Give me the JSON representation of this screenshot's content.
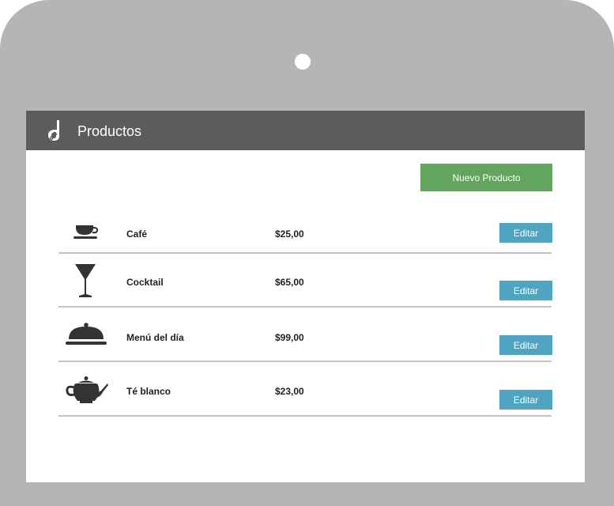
{
  "header": {
    "title": "Productos",
    "logo_icon": "whisk-logo-icon"
  },
  "actions": {
    "new_product_label": "Nuevo Producto"
  },
  "products": [
    {
      "icon": "coffee-cup-icon",
      "name": "Café",
      "price": "$25,00",
      "edit_label": "Editar"
    },
    {
      "icon": "cocktail-glass-icon",
      "name": "Cocktail",
      "price": "$65,00",
      "edit_label": "Editar"
    },
    {
      "icon": "cloche-icon",
      "name": "Menú del día",
      "price": "$99,00",
      "edit_label": "Editar"
    },
    {
      "icon": "teapot-icon",
      "name": "Té blanco",
      "price": "$23,00",
      "edit_label": "Editar"
    }
  ],
  "colors": {
    "device_frame": "#b5b5b5",
    "header_bg": "#5c5c5c",
    "primary_button": "#62a55e",
    "edit_button": "#4fa5c1",
    "divider": "#c4c4c4",
    "icon": "#333333"
  }
}
